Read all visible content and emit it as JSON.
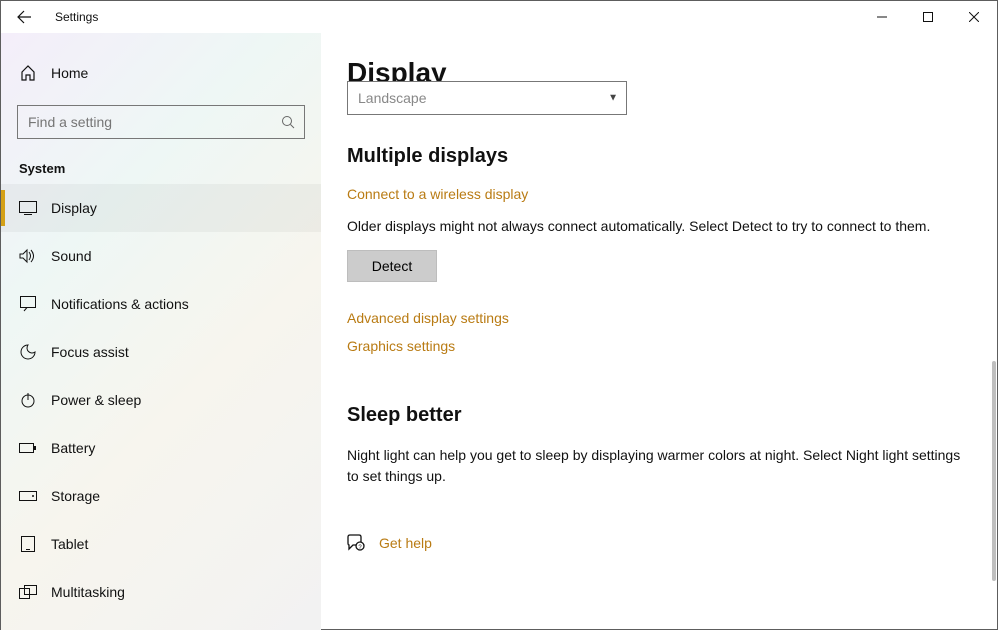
{
  "window": {
    "title": "Settings"
  },
  "sidebar": {
    "home_label": "Home",
    "search_placeholder": "Find a setting",
    "section_label": "System",
    "items": [
      {
        "label": "Display",
        "icon": "display-icon",
        "active": true
      },
      {
        "label": "Sound",
        "icon": "sound-icon",
        "active": false
      },
      {
        "label": "Notifications & actions",
        "icon": "notifications-icon",
        "active": false
      },
      {
        "label": "Focus assist",
        "icon": "focus-assist-icon",
        "active": false
      },
      {
        "label": "Power & sleep",
        "icon": "power-icon",
        "active": false
      },
      {
        "label": "Battery",
        "icon": "battery-icon",
        "active": false
      },
      {
        "label": "Storage",
        "icon": "storage-icon",
        "active": false
      },
      {
        "label": "Tablet",
        "icon": "tablet-icon",
        "active": false
      },
      {
        "label": "Multitasking",
        "icon": "multitasking-icon",
        "active": false
      }
    ]
  },
  "main": {
    "page_title": "Display",
    "orientation_value": "Landscape",
    "multiple_displays": {
      "heading": "Multiple displays",
      "link_connect": "Connect to a wireless display",
      "older_text": "Older displays might not always connect automatically. Select Detect to try to connect to them.",
      "detect_label": "Detect",
      "link_advanced": "Advanced display settings",
      "link_graphics": "Graphics settings"
    },
    "sleep_better": {
      "heading": "Sleep better",
      "description": "Night light can help you get to sleep by displaying warmer colors at night. Select Night light settings to set things up."
    },
    "get_help_label": "Get help"
  }
}
